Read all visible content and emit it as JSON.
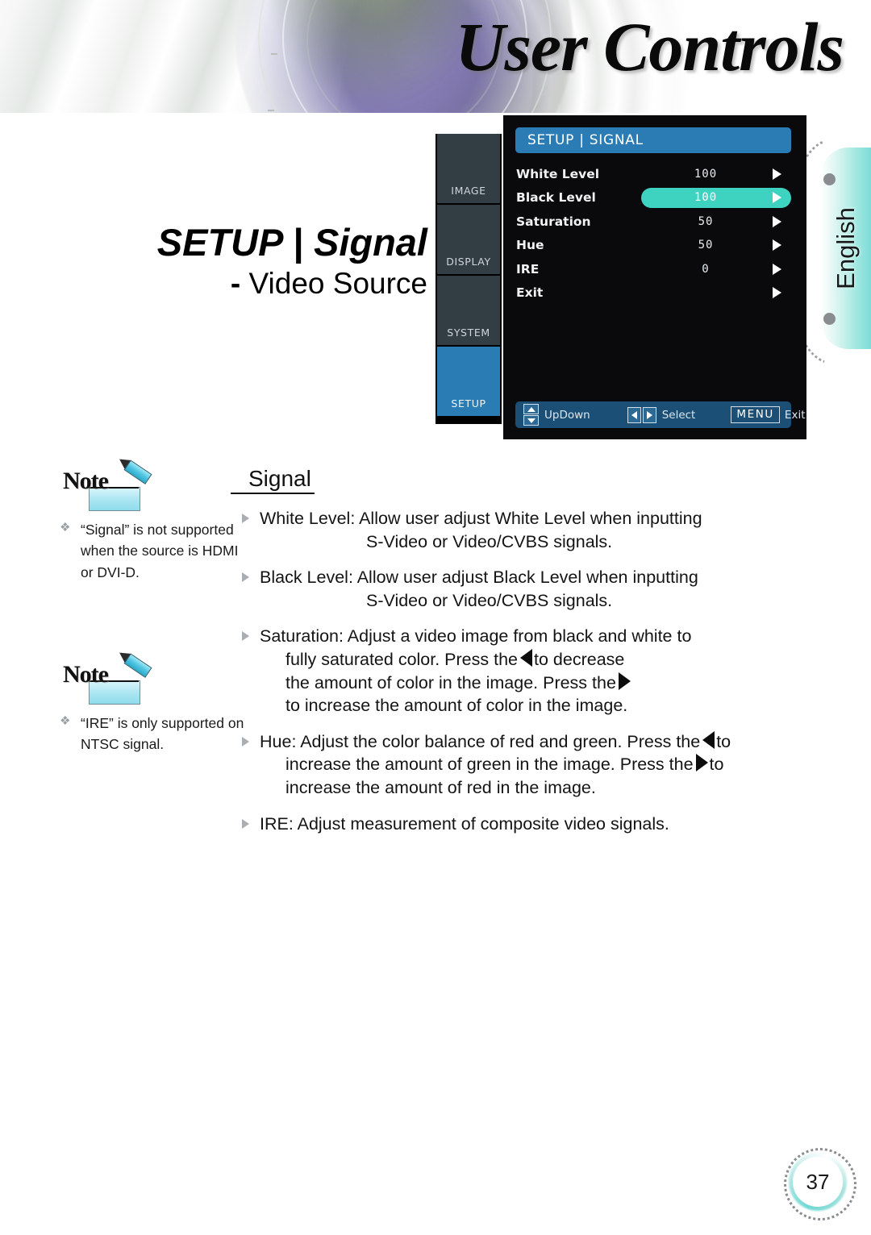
{
  "header": {
    "title": "User Controls",
    "lens_image": "projector-lens-photo"
  },
  "side_tab": {
    "language": "English"
  },
  "page_title": {
    "main": "SETUP | Signal",
    "subtitle_dash": "-",
    "subtitle": "Video Source"
  },
  "osd": {
    "header": "SETUP | SIGNAL",
    "sidebar": [
      {
        "label": "IMAGE",
        "active": false
      },
      {
        "label": "DISPLAY",
        "active": false
      },
      {
        "label": "SYSTEM",
        "active": false
      },
      {
        "label": "SETUP",
        "active": true
      }
    ],
    "rows": [
      {
        "label": "White Level",
        "value": "100",
        "selected": false
      },
      {
        "label": "Black Level",
        "value": "100",
        "selected": true
      },
      {
        "label": "Saturation",
        "value": "50",
        "selected": false
      },
      {
        "label": "Hue",
        "value": "50",
        "selected": false
      },
      {
        "label": "IRE",
        "value": "0",
        "selected": false
      },
      {
        "label": "Exit",
        "value": "",
        "selected": false
      }
    ],
    "footer": {
      "updown_label": "UpDown",
      "select_label": "Select",
      "menu_key": "MENU",
      "exit_label": "Exit"
    },
    "colors": {
      "header_blue": "#2b7cb4",
      "highlight_teal": "#3ed2c1",
      "panel_black": "#0a0a0c",
      "tab_grey": "#333d44",
      "tab_active_blue": "#2a7cb5",
      "footer_blue": "#1b4f75"
    }
  },
  "notes": [
    {
      "badge": "Note",
      "bullet": "❖",
      "text": "“Signal” is not supported when the source is HDMI or DVI-D."
    },
    {
      "badge": "Note",
      "bullet": "❖",
      "text": "“IRE” is only supported on NTSC signal."
    }
  ],
  "content": {
    "heading": "Signal",
    "items": [
      {
        "lines": [
          {
            "text": "White Level: Allow user adjust White Level when inputting",
            "indent": "none"
          },
          {
            "text": "S-Video or Video/CVBS signals.",
            "indent": "deep"
          }
        ]
      },
      {
        "lines": [
          {
            "text": "Black Level: Allow user adjust Black Level when inputting",
            "indent": "none"
          },
          {
            "text": "S-Video or Video/CVBS signals.",
            "indent": "deep"
          }
        ]
      },
      {
        "lines": [
          {
            "text": "Saturation: Adjust a video image from black and white to",
            "indent": "none"
          },
          {
            "text": "fully saturated color. Press the",
            "indent": "mid",
            "glyph": "left-arrow",
            "after": "to decrease"
          },
          {
            "text": "the amount of color in the image. Press the",
            "indent": "mid",
            "glyph": "right-arrow",
            "after": ""
          },
          {
            "text": "to increase the amount of color in the image.",
            "indent": "mid"
          }
        ]
      },
      {
        "lines": [
          {
            "text": "Hue: Adjust the color balance of red and green. Press the",
            "indent": "none",
            "glyph": "left-arrow",
            "after": "to"
          },
          {
            "text": "increase the amount of green in the image. Press the",
            "indent": "mid2",
            "glyph": "right-arrow",
            "after": "to"
          },
          {
            "text": "increase the amount of red in the image.",
            "indent": "mid2"
          }
        ]
      },
      {
        "lines": [
          {
            "text": "IRE: Adjust measurement of composite video signals.",
            "indent": "none"
          }
        ]
      }
    ]
  },
  "page_number": "37"
}
